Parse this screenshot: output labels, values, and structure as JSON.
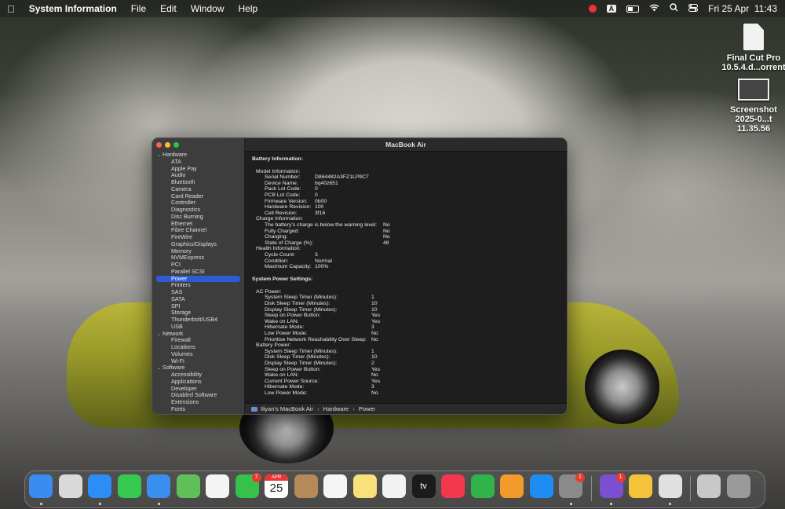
{
  "menubar": {
    "apple_icon": "apple-logo",
    "app_name": "System Information",
    "menus": [
      "File",
      "Edit",
      "Window",
      "Help"
    ],
    "status_icons": [
      "record-icon",
      "text-input-icon",
      "battery-icon",
      "wifi-icon",
      "search-icon",
      "control-center-icon"
    ],
    "input_source": "A",
    "clock": "Fri 25 Apr  11:43"
  },
  "desktop": {
    "items": [
      {
        "label_line1": "Final Cut Pro",
        "label_line2": "10.5.4.d...orrent",
        "icon": "document-icon"
      },
      {
        "label_line1": "Screenshot",
        "label_line2": "2025-0...t 11.35.56",
        "icon": "screenshot-thumbnail"
      }
    ]
  },
  "window": {
    "title": "MacBook Air",
    "sidebar": [
      {
        "type": "cat",
        "label": "Hardware"
      },
      {
        "type": "item",
        "label": "ATA"
      },
      {
        "type": "item",
        "label": "Apple Pay"
      },
      {
        "type": "item",
        "label": "Audio"
      },
      {
        "type": "item",
        "label": "Bluetooth"
      },
      {
        "type": "item",
        "label": "Camera"
      },
      {
        "type": "item",
        "label": "Card Reader"
      },
      {
        "type": "item",
        "label": "Controller"
      },
      {
        "type": "item",
        "label": "Diagnostics"
      },
      {
        "type": "item",
        "label": "Disc Burning"
      },
      {
        "type": "item",
        "label": "Ethernet"
      },
      {
        "type": "item",
        "label": "Fibre Channel"
      },
      {
        "type": "item",
        "label": "FireWire"
      },
      {
        "type": "item",
        "label": "Graphics/Displays"
      },
      {
        "type": "item",
        "label": "Memory"
      },
      {
        "type": "item",
        "label": "NVMExpress"
      },
      {
        "type": "item",
        "label": "PCI"
      },
      {
        "type": "item",
        "label": "Parallel SCSI"
      },
      {
        "type": "item",
        "label": "Power",
        "selected": true
      },
      {
        "type": "item",
        "label": "Printers"
      },
      {
        "type": "item",
        "label": "SAS"
      },
      {
        "type": "item",
        "label": "SATA"
      },
      {
        "type": "item",
        "label": "SPI"
      },
      {
        "type": "item",
        "label": "Storage"
      },
      {
        "type": "item",
        "label": "Thunderbolt/USB4"
      },
      {
        "type": "item",
        "label": "USB"
      },
      {
        "type": "cat",
        "label": "Network"
      },
      {
        "type": "item",
        "label": "Firewall"
      },
      {
        "type": "item",
        "label": "Locations"
      },
      {
        "type": "item",
        "label": "Volumes"
      },
      {
        "type": "item",
        "label": "Wi-Fi"
      },
      {
        "type": "cat",
        "label": "Software"
      },
      {
        "type": "item",
        "label": "Accessibility"
      },
      {
        "type": "item",
        "label": "Applications"
      },
      {
        "type": "item",
        "label": "Developer"
      },
      {
        "type": "item",
        "label": "Disabled Software"
      },
      {
        "type": "item",
        "label": "Extensions"
      },
      {
        "type": "item",
        "label": "Fonts"
      }
    ],
    "report": [
      {
        "t": "h",
        "k": "Battery Information:"
      },
      {
        "t": "gap"
      },
      {
        "t": "r",
        "lvl": 1,
        "k": "Model Information:",
        "v": ""
      },
      {
        "t": "r",
        "lvl": 2,
        "k": "Serial Number:",
        "v": "D864482A3FZ1LP9C7",
        "col": "a"
      },
      {
        "t": "r",
        "lvl": 2,
        "k": "Device Name:",
        "v": "bq40z651",
        "col": "a"
      },
      {
        "t": "r",
        "lvl": 2,
        "k": "Pack Lot Code:",
        "v": "0",
        "col": "a"
      },
      {
        "t": "r",
        "lvl": 2,
        "k": "PCB Lot Code:",
        "v": "0",
        "col": "a"
      },
      {
        "t": "r",
        "lvl": 2,
        "k": "Firmware Version:",
        "v": "0b00",
        "col": "a"
      },
      {
        "t": "r",
        "lvl": 2,
        "k": "Hardware Revision:",
        "v": "100",
        "col": "a"
      },
      {
        "t": "r",
        "lvl": 2,
        "k": "Cell Revision:",
        "v": "3f16",
        "col": "a"
      },
      {
        "t": "r",
        "lvl": 1,
        "k": "Charge Information:",
        "v": ""
      },
      {
        "t": "r",
        "lvl": 2,
        "k": "The battery’s charge is below the warning level:",
        "v": "No",
        "col": "b"
      },
      {
        "t": "r",
        "lvl": 2,
        "k": "Fully Charged:",
        "v": "No",
        "col": "b"
      },
      {
        "t": "r",
        "lvl": 2,
        "k": "Charging:",
        "v": "No",
        "col": "b"
      },
      {
        "t": "r",
        "lvl": 2,
        "k": "State of Charge (%):",
        "v": "48",
        "col": "b"
      },
      {
        "t": "r",
        "lvl": 1,
        "k": "Health Information:",
        "v": ""
      },
      {
        "t": "r",
        "lvl": 2,
        "k": "Cycle Count:",
        "v": "3",
        "col": "c"
      },
      {
        "t": "r",
        "lvl": 2,
        "k": "Condition:",
        "v": "Normal",
        "col": "c"
      },
      {
        "t": "r",
        "lvl": 2,
        "k": "Maximum Capacity:",
        "v": "100%",
        "col": "c"
      },
      {
        "t": "gap"
      },
      {
        "t": "h",
        "k": "System Power Settings:"
      },
      {
        "t": "gap"
      },
      {
        "t": "r",
        "lvl": 1,
        "k": "AC Power:",
        "v": ""
      },
      {
        "t": "r",
        "lvl": 2,
        "k": "System Sleep Timer (Minutes):",
        "v": "1",
        "col": "d"
      },
      {
        "t": "r",
        "lvl": 2,
        "k": "Disk Sleep Timer (Minutes):",
        "v": "10",
        "col": "d"
      },
      {
        "t": "r",
        "lvl": 2,
        "k": "Display Sleep Timer (Minutes):",
        "v": "10",
        "col": "d"
      },
      {
        "t": "r",
        "lvl": 2,
        "k": "Sleep on Power Button:",
        "v": "Yes",
        "col": "d"
      },
      {
        "t": "r",
        "lvl": 2,
        "k": "Wake on LAN:",
        "v": "Yes",
        "col": "d"
      },
      {
        "t": "r",
        "lvl": 2,
        "k": "Hibernate Mode:",
        "v": "3",
        "col": "d"
      },
      {
        "t": "r",
        "lvl": 2,
        "k": "Low Power Mode:",
        "v": "No",
        "col": "d"
      },
      {
        "t": "r",
        "lvl": 2,
        "k": "Prioritise Network Reachability Over Sleep:",
        "v": "No",
        "col": "d"
      },
      {
        "t": "r",
        "lvl": 1,
        "k": "Battery Power:",
        "v": ""
      },
      {
        "t": "r",
        "lvl": 2,
        "k": "System Sleep Timer (Minutes):",
        "v": "1",
        "col": "d"
      },
      {
        "t": "r",
        "lvl": 2,
        "k": "Disk Sleep Timer (Minutes):",
        "v": "10",
        "col": "d"
      },
      {
        "t": "r",
        "lvl": 2,
        "k": "Display Sleep Timer (Minutes):",
        "v": "2",
        "col": "d"
      },
      {
        "t": "r",
        "lvl": 2,
        "k": "Sleep on Power Button:",
        "v": "Yes",
        "col": "d"
      },
      {
        "t": "r",
        "lvl": 2,
        "k": "Wake on LAN:",
        "v": "No",
        "col": "d"
      },
      {
        "t": "r",
        "lvl": 2,
        "k": "Current Power Source:",
        "v": "Yes",
        "col": "d"
      },
      {
        "t": "r",
        "lvl": 2,
        "k": "Hibernate Mode:",
        "v": "3",
        "col": "d"
      },
      {
        "t": "r",
        "lvl": 2,
        "k": "Low Power Mode:",
        "v": "No",
        "col": "d"
      }
    ],
    "pathbar": [
      "Iliyan’s MacBook Air",
      "Hardware",
      "Power"
    ],
    "pathbar_sep": "›"
  },
  "dock": {
    "apps": [
      {
        "name": "finder-icon",
        "color": "#3b8cf0",
        "running": true
      },
      {
        "name": "launchpad-icon",
        "color": "#d9d9d9",
        "running": false
      },
      {
        "name": "safari-icon",
        "color": "#2b8df5",
        "running": true
      },
      {
        "name": "messages-icon",
        "color": "#37c84f",
        "running": false
      },
      {
        "name": "mail-icon",
        "color": "#3a8ef0",
        "running": true
      },
      {
        "name": "maps-icon",
        "color": "#5fc05a",
        "running": false
      },
      {
        "name": "photos-icon",
        "color": "#f4f4f4",
        "running": false
      },
      {
        "name": "facetime-icon",
        "color": "#36c14c",
        "running": false,
        "badge": "7"
      },
      {
        "name": "calendar-icon",
        "color": "#ffffff",
        "running": false,
        "cal_month": "APR",
        "cal_day": "25"
      },
      {
        "name": "contacts-icon",
        "color": "#b48a58",
        "running": false
      },
      {
        "name": "reminders-icon",
        "color": "#f5f5f5",
        "running": false
      },
      {
        "name": "notes-icon",
        "color": "#f8e07a",
        "running": false
      },
      {
        "name": "freeform-icon",
        "color": "#f2f2f2",
        "running": false
      },
      {
        "name": "appletv-icon",
        "color": "#1b1b1b",
        "running": false,
        "text": "tv"
      },
      {
        "name": "music-icon",
        "color": "#f2374e",
        "running": false
      },
      {
        "name": "numbers-icon",
        "color": "#30b34a",
        "running": false
      },
      {
        "name": "pages-icon",
        "color": "#f39a2d",
        "running": false
      },
      {
        "name": "app-store-icon",
        "color": "#1f8cf4",
        "running": false
      },
      {
        "name": "system-settings-icon",
        "color": "#8a8a8a",
        "running": true,
        "badge": "1"
      },
      {
        "name": "viber-icon",
        "color": "#7a4fd0",
        "running": true,
        "badge": "1"
      },
      {
        "name": "tips-icon",
        "color": "#f5c33a",
        "running": false
      },
      {
        "name": "system-information-icon",
        "color": "#e0e0e0",
        "running": true
      },
      {
        "name": "downloads-folder-icon",
        "color": "#c8c8c8",
        "running": false
      },
      {
        "name": "trash-icon",
        "color": "#9a9a9a",
        "running": false
      }
    ]
  }
}
